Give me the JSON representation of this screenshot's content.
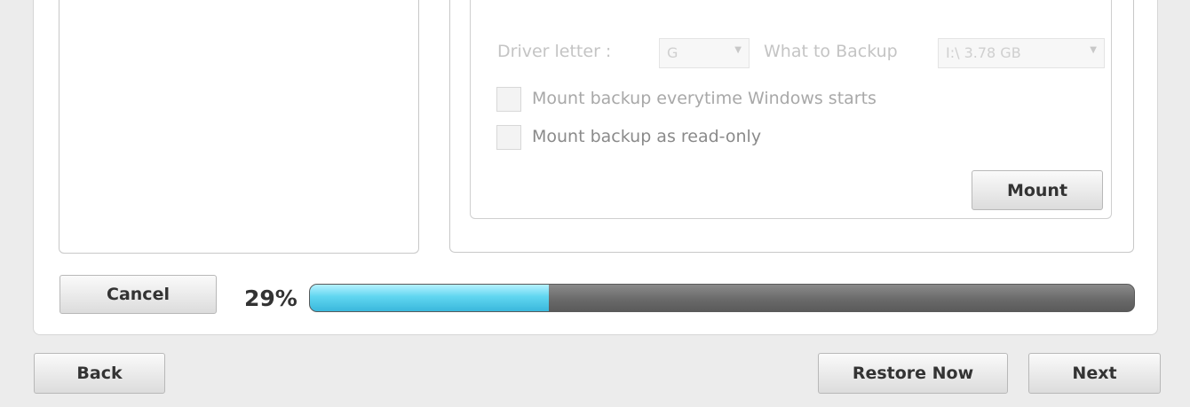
{
  "mount_panel": {
    "drive_letter_label": "Driver letter :",
    "drive_letter_value": "G",
    "what_to_backup_label": "What to Backup",
    "what_to_backup_value": "I:\\ 3.78 GB",
    "mount_on_start_label": "Mount backup everytime Windows starts",
    "mount_read_only_label": "Mount backup as read-only",
    "mount_button": "Mount"
  },
  "progress": {
    "cancel_button": "Cancel",
    "percent_text": "29%",
    "value": 0.29
  },
  "footer": {
    "back_button": "Back",
    "restore_now_button": "Restore Now",
    "next_button": "Next"
  },
  "colors": {
    "progress_fill": "#5fd5f0",
    "progress_track": "#6b6b6b"
  }
}
